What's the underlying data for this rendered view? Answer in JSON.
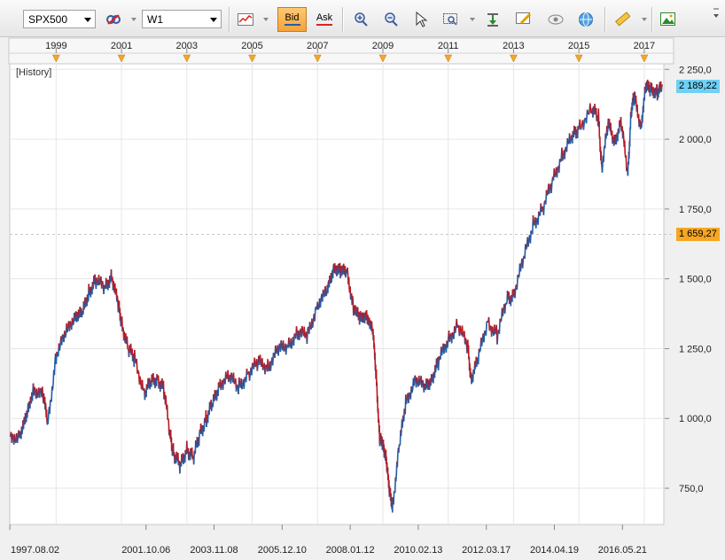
{
  "toolbar": {
    "symbol": "SPX500",
    "timeframe": "W1",
    "bid_label": "Bid",
    "ask_label": "Ask"
  },
  "history_label": "[History]",
  "current_price_label": "2 189,22",
  "crosshair_price_label": "1 659,27",
  "colors": {
    "up": "#1f5fa8",
    "down": "#c0161c",
    "current_badge": "#6fd0f5",
    "crosshair_badge": "#f5a623",
    "grid": "#e6e6e6"
  },
  "chart_data": {
    "type": "line",
    "x_axis_top": [
      "1999",
      "2001",
      "2003",
      "2005",
      "2007",
      "2009",
      "2011",
      "2013",
      "2015",
      "2017"
    ],
    "x_axis_bottom": [
      "1997.08.02",
      "2001.10.06",
      "2003.11.08",
      "2005.12.10",
      "2008.01.12",
      "2010.02.13",
      "2012.03.17",
      "2014.04.19",
      "2016.05.21"
    ],
    "y_ticks": [
      750,
      1000,
      1250,
      1500,
      1750,
      2000,
      2250
    ],
    "y_tick_labels": [
      "750,0",
      "1 000,0",
      "1 250,0",
      "1 500,0",
      "1 750,0",
      "2 000,0",
      "2 250,0"
    ],
    "ylim": [
      620,
      2270
    ],
    "xlim": [
      1997.58,
      2017.6
    ],
    "current_price": 2189.22,
    "crosshair_price": 1659.27,
    "series": [
      {
        "x": [
          1997.6,
          1997.9,
          1998.1,
          1998.3,
          1998.6,
          1998.75,
          1999.0,
          1999.3,
          1999.6,
          1999.8,
          2000.0,
          2000.2,
          2000.5,
          2000.7,
          2000.9,
          2001.0,
          2001.2,
          2001.4,
          2001.7,
          2001.9,
          2002.1,
          2002.3,
          2002.5,
          2002.6,
          2002.8,
          2003.0,
          2003.2,
          2003.4,
          2003.6,
          2003.8,
          2004.0,
          2004.3,
          2004.6,
          2004.9,
          2005.2,
          2005.5,
          2005.8,
          2006.1,
          2006.4,
          2006.7,
          2007.0,
          2007.3,
          2007.5,
          2007.7,
          2007.9,
          2008.1,
          2008.3,
          2008.5,
          2008.7,
          2008.8,
          2008.9,
          2009.0,
          2009.1,
          2009.2,
          2009.3,
          2009.5,
          2009.7,
          2010.0,
          2010.3,
          2010.5,
          2010.7,
          2011.0,
          2011.3,
          2011.6,
          2011.7,
          2011.9,
          2012.2,
          2012.5,
          2012.8,
          2013.0,
          2013.3,
          2013.6,
          2013.9,
          2014.2,
          2014.5,
          2014.8,
          2015.0,
          2015.4,
          2015.6,
          2015.7,
          2015.9,
          2016.1,
          2016.3,
          2016.5,
          2016.6,
          2016.7,
          2016.9,
          2017.05,
          2017.2,
          2017.4,
          2017.55
        ],
        "y": [
          920,
          950,
          1000,
          1110,
          1080,
          985,
          1230,
          1300,
          1380,
          1370,
          1450,
          1500,
          1460,
          1520,
          1400,
          1350,
          1250,
          1210,
          1100,
          1120,
          1150,
          1100,
          930,
          880,
          820,
          900,
          850,
          950,
          1000,
          1050,
          1130,
          1140,
          1120,
          1160,
          1200,
          1190,
          1240,
          1270,
          1300,
          1300,
          1410,
          1450,
          1550,
          1520,
          1530,
          1400,
          1350,
          1380,
          1300,
          1150,
          930,
          900,
          870,
          730,
          690,
          900,
          1050,
          1150,
          1100,
          1150,
          1200,
          1280,
          1340,
          1250,
          1150,
          1200,
          1350,
          1300,
          1420,
          1450,
          1560,
          1700,
          1750,
          1850,
          1950,
          2000,
          2050,
          2100,
          2080,
          1900,
          2050,
          2000,
          2050,
          1880,
          2100,
          2150,
          2050,
          2180,
          2190,
          2160,
          2189
        ]
      }
    ]
  }
}
